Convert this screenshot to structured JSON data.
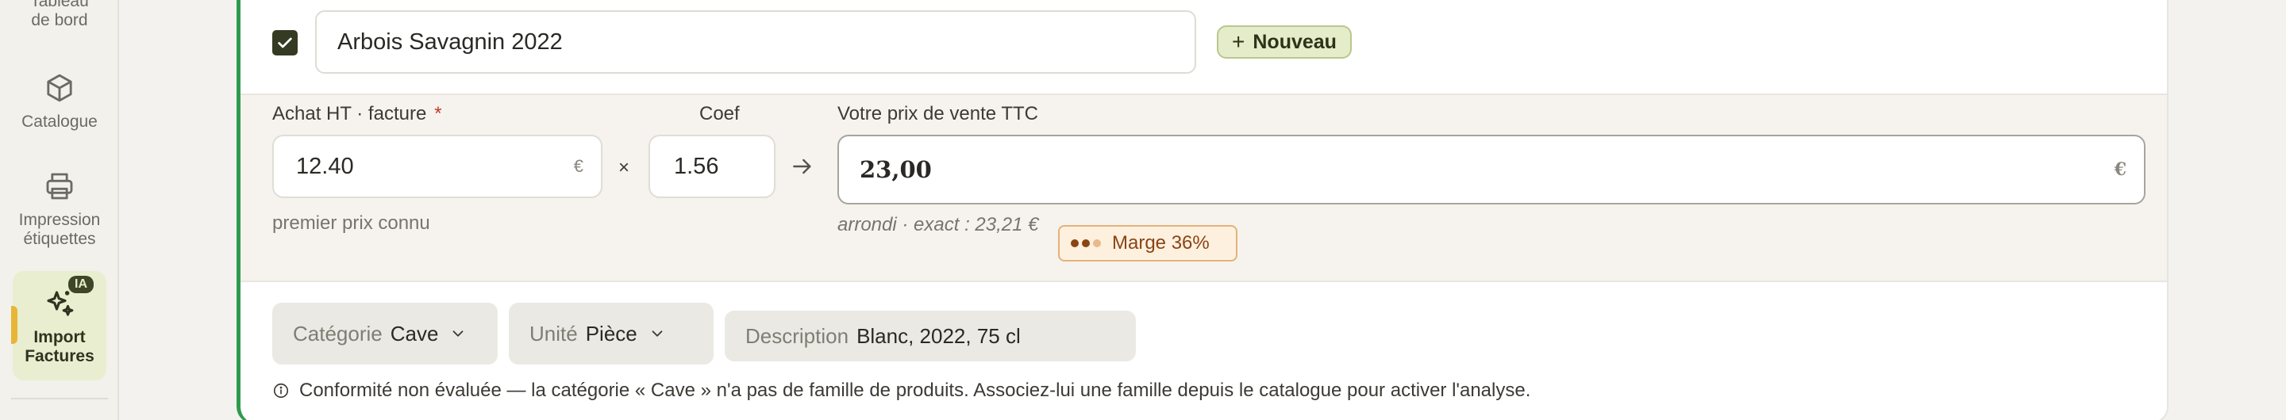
{
  "sidebar": {
    "items": [
      {
        "label_line1": "Tableau",
        "label_line2": "de bord",
        "icon": "dashboard-icon"
      },
      {
        "label": "Catalogue",
        "icon": "box-icon"
      },
      {
        "label_line1": "Impression",
        "label_line2": "étiquettes",
        "icon": "printer-icon"
      },
      {
        "label_line1": "Import",
        "label_line2": "Factures",
        "icon": "sparkles-icon",
        "badge": "IA",
        "active": true
      }
    ],
    "accent_color": "#e8b637"
  },
  "product": {
    "checked": true,
    "name": "Arbois Savagnin 2022",
    "new_button_label": "Nouveau"
  },
  "pricing": {
    "purchase_label": "Achat HT · facture",
    "required_mark": "*",
    "purchase_value": "12.40",
    "currency": "€",
    "purchase_hint": "premier prix connu",
    "times_symbol": "×",
    "coef_label": "Coef",
    "coef_value": "1.56",
    "sell_label": "Votre prix de vente TTC",
    "sell_value": "23,00",
    "rounding_hint": "arrondi · exact : 23,21 €",
    "margin_label": "Marge 36%",
    "margin_level": 2,
    "margin_level_max": 3
  },
  "attributes": {
    "category_label": "Catégorie",
    "category_value": "Cave",
    "unit_label": "Unité",
    "unit_value": "Pièce",
    "description_label": "Description",
    "description_value": "Blanc, 2022, 75 cl"
  },
  "notice": {
    "text": "Conformité non évaluée — la catégorie « Cave » n'a pas de famille de produits. Associez-lui une famille depuis le catalogue pour activer l'analyse."
  },
  "colors": {
    "card_accent": "#2f9a4d",
    "checkbox": "#353a22",
    "new_button_bg": "#e4ecc9",
    "margin_badge_bg": "#fdf0df",
    "margin_badge_text": "#8b4414"
  }
}
